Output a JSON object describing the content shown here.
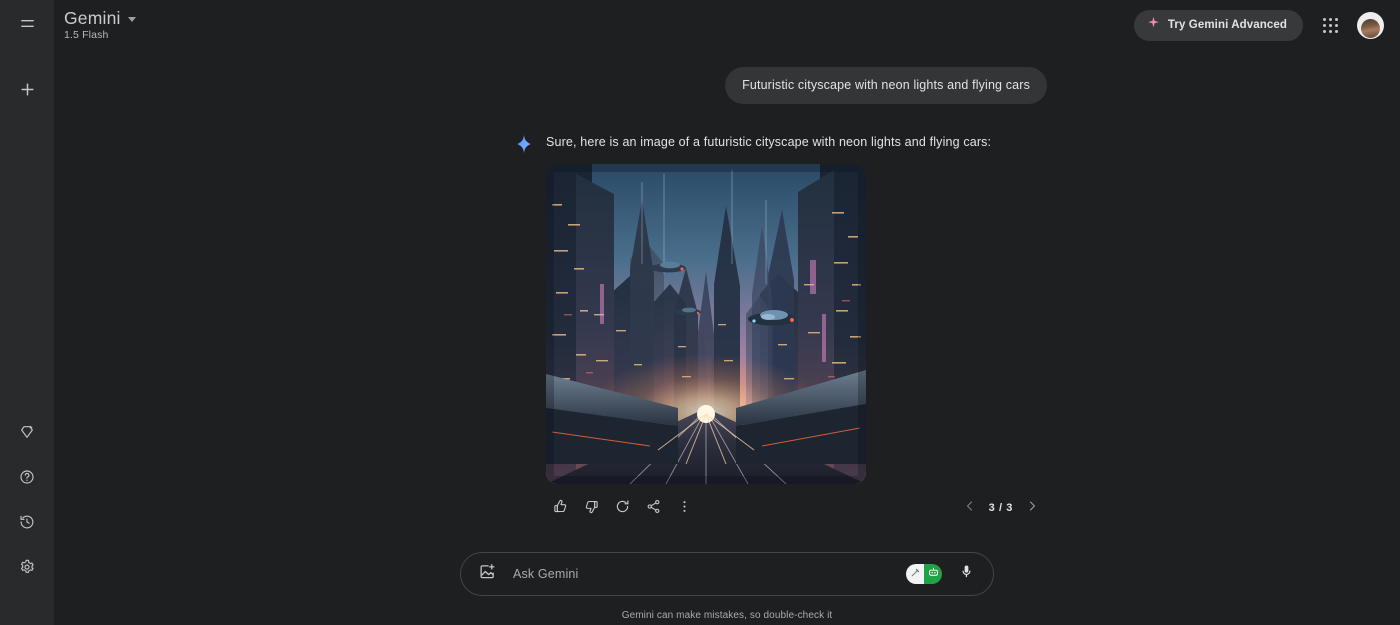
{
  "sidebar": {
    "menu_icon": "hamburger-menu-icon",
    "new_chat_icon": "plus-icon",
    "bottom_items": [
      {
        "icon": "gem-sparkle-icon",
        "name": "upgrade"
      },
      {
        "icon": "help-circle-icon",
        "name": "help"
      },
      {
        "icon": "history-clock-icon",
        "name": "activity"
      },
      {
        "icon": "settings-gear-icon",
        "name": "settings"
      }
    ]
  },
  "header": {
    "title": "Gemini",
    "model": "1.5 Flash",
    "advanced_button": "Try Gemini Advanced",
    "advanced_icon": "sparkle-icon",
    "apps_icon": "apps-grid-icon",
    "avatar_icon": "user-avatar"
  },
  "conversation": {
    "user_prompt": "Futuristic cityscape with neon lights and flying cars",
    "assistant_icon": "gemini-sparkle-icon",
    "assistant_text": "Sure, here is an image of a futuristic cityscape with neon lights and flying cars:",
    "image_alt": "futuristic-cityscape-neon-flying-cars"
  },
  "actions": {
    "thumbs_up": "thumb-up-icon",
    "thumbs_down": "thumb-down-icon",
    "regenerate": "refresh-icon",
    "share": "share-icon",
    "more": "more-vertical-icon",
    "prev": "chevron-left-icon",
    "next": "chevron-right-icon",
    "page_count": "3 / 3"
  },
  "input": {
    "upload_icon": "add-image-icon",
    "placeholder": "Ask Gemini",
    "value": "",
    "toggle_left_icon": "pen-icon",
    "toggle_right_icon": "robot-icon",
    "mic_icon": "microphone-icon"
  },
  "footer": {
    "disclaimer": "Gemini can make mistakes, so double-check it"
  },
  "colors": {
    "sidebar_bg": "#282a2c",
    "main_bg": "#1e1f20",
    "bubble_bg": "#333537",
    "accent_green": "#1ea446",
    "accent_pink": "#f28ba8",
    "text_primary": "#e3e3e3",
    "text_muted": "#a8abad"
  }
}
